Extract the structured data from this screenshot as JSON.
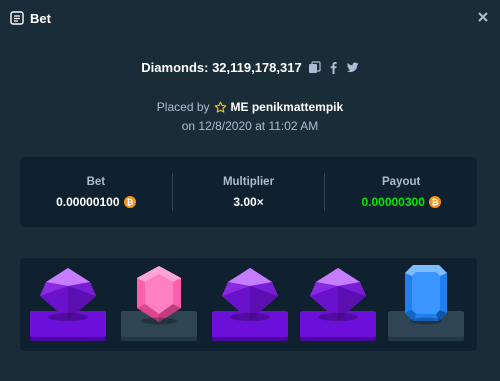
{
  "header": {
    "title": "Bet",
    "title_icon": "bet-slip-icon",
    "close_icon": "close-icon"
  },
  "summary": {
    "diamonds_text": "Diamonds: 32,119,178,317",
    "share_icons": [
      "copy-icon",
      "facebook-icon",
      "twitter-icon"
    ],
    "placed_by_prefix": "Placed by",
    "user_badge_icon": "star-icon",
    "user_name": "ME penikmattempik",
    "date_text": "on 12/8/2020 at 11:02 AM"
  },
  "stats": {
    "bet_label": "Bet",
    "bet_value": "0.00000100",
    "multiplier_label": "Multiplier",
    "multiplier_value": "3.00×",
    "payout_label": "Payout",
    "payout_value": "0.00000300",
    "currency_icon": "bitcoin-icon"
  },
  "gems": [
    {
      "gem": "purple-diamond",
      "base": "purple"
    },
    {
      "gem": "pink-gem",
      "base": "gray"
    },
    {
      "gem": "purple-diamond",
      "base": "purple"
    },
    {
      "gem": "purple-diamond",
      "base": "purple"
    },
    {
      "gem": "blue-gem",
      "base": "gray"
    }
  ],
  "colors": {
    "background": "#1a2c38",
    "panel": "#0f212e",
    "payout_green": "#00e701",
    "purple_base": "#6b0fd9",
    "gray_base": "#2f4553",
    "btc_orange": "#f7931a"
  }
}
